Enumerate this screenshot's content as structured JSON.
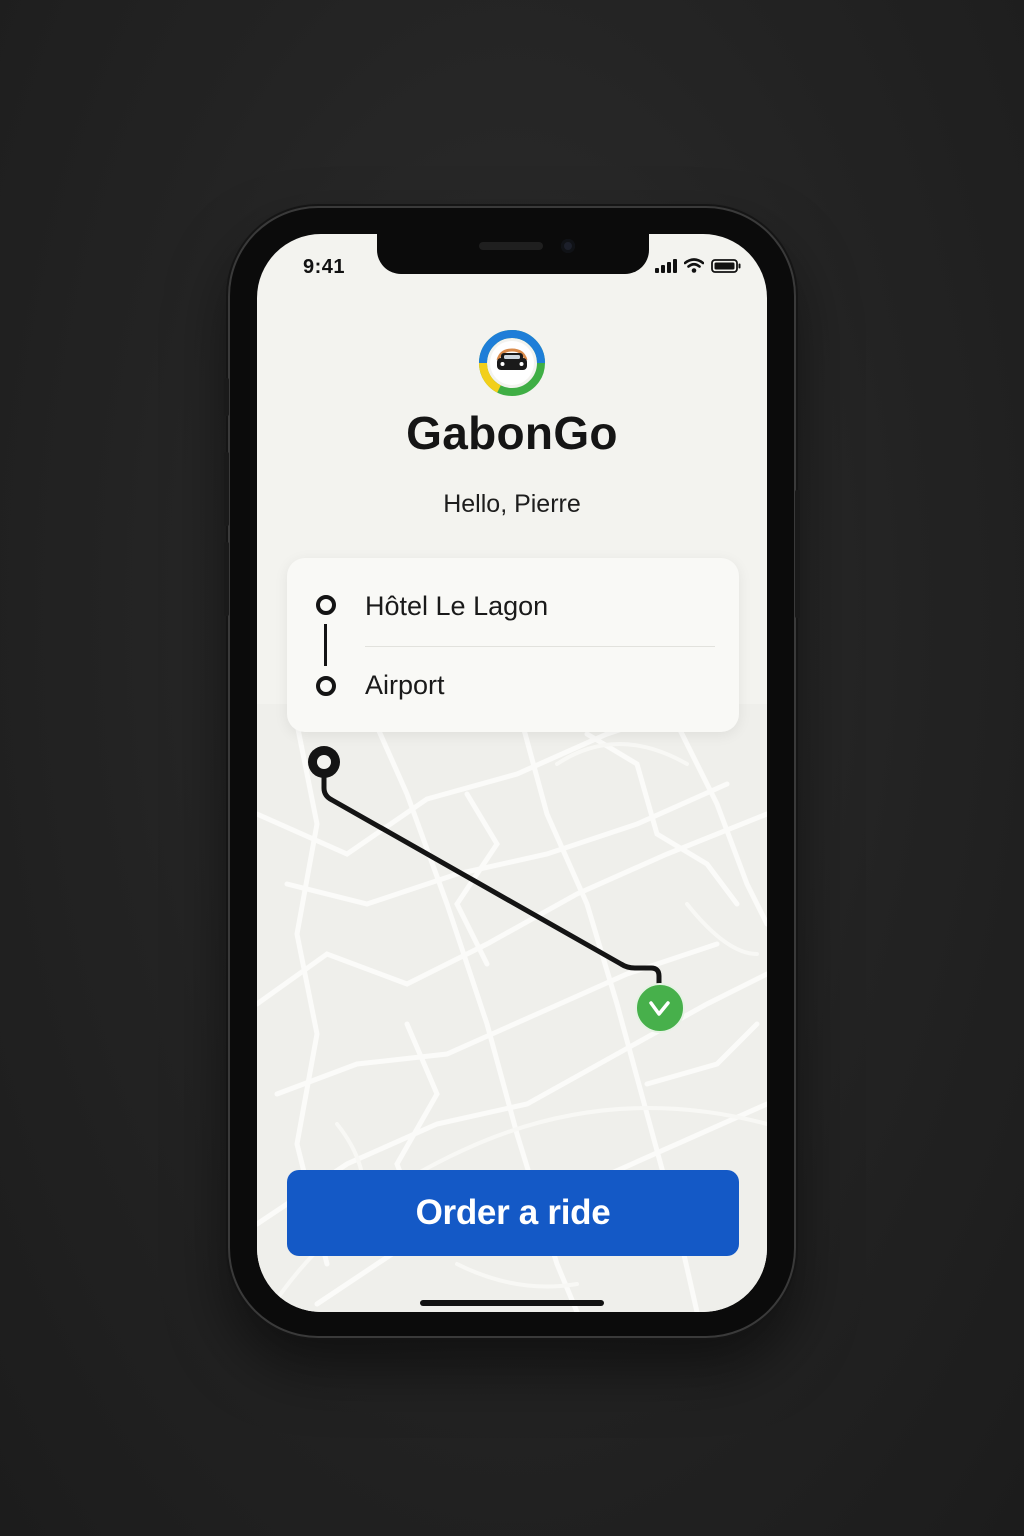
{
  "status_bar": {
    "time": "9:41",
    "icons": [
      "signal-icon",
      "wifi-icon",
      "battery-icon"
    ]
  },
  "app": {
    "logo_icon": "car-logo-icon",
    "name": "GabonGo",
    "greeting": "Hello, Pierre"
  },
  "route": {
    "pickup": "Hôtel Le Lagon",
    "destination": "Airport"
  },
  "map": {
    "start_marker_icon": "origin-pin-icon",
    "end_marker_icon": "check-destination-icon"
  },
  "actions": {
    "order_label": "Order a ride"
  },
  "colors": {
    "primary": "#1459c6",
    "destination_marker": "#47b04b",
    "logo_blue": "#1e7ed8",
    "logo_green": "#3fae45",
    "logo_yellow": "#f2cf1a",
    "background": "#f3f3ef"
  }
}
